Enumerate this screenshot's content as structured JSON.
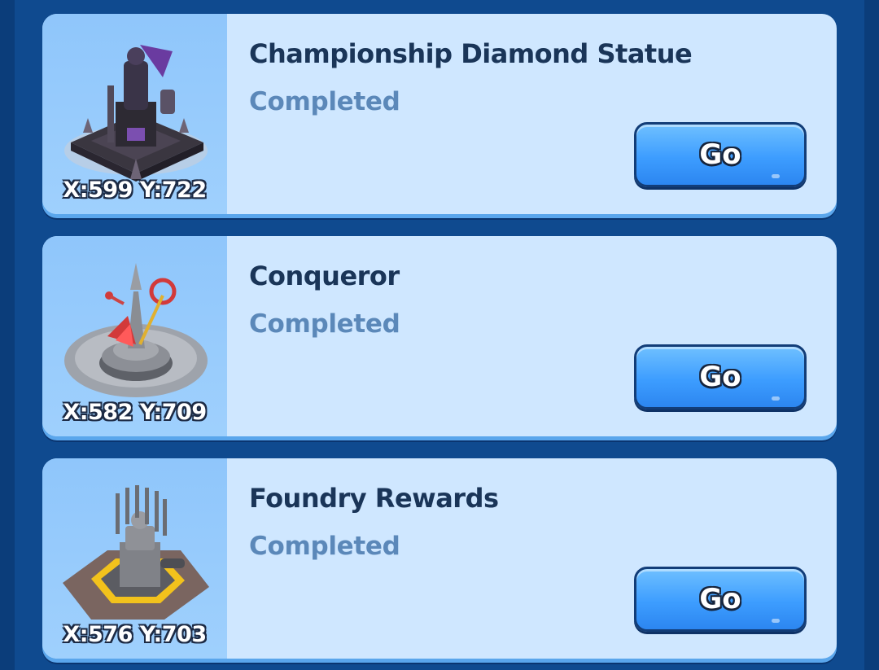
{
  "entries": [
    {
      "title": "Championship Diamond Statue",
      "status": "Completed",
      "coords": "X:599 Y:722",
      "button": "Go",
      "image_icon": "diamond-statue-icon"
    },
    {
      "title": "Conqueror",
      "status": "Completed",
      "coords": "X:582 Y:709",
      "button": "Go",
      "image_icon": "conqueror-statue-icon"
    },
    {
      "title": "Foundry Rewards",
      "status": "Completed",
      "coords": "X:576 Y:703",
      "button": "Go",
      "image_icon": "foundry-throne-icon"
    }
  ],
  "colors": {
    "background": "#0f4a8f",
    "card": "#cfe7ff",
    "thumb": "#8fc6fb",
    "title": "#1a3558",
    "status": "#5b88b9",
    "button": "#3d9dff"
  }
}
